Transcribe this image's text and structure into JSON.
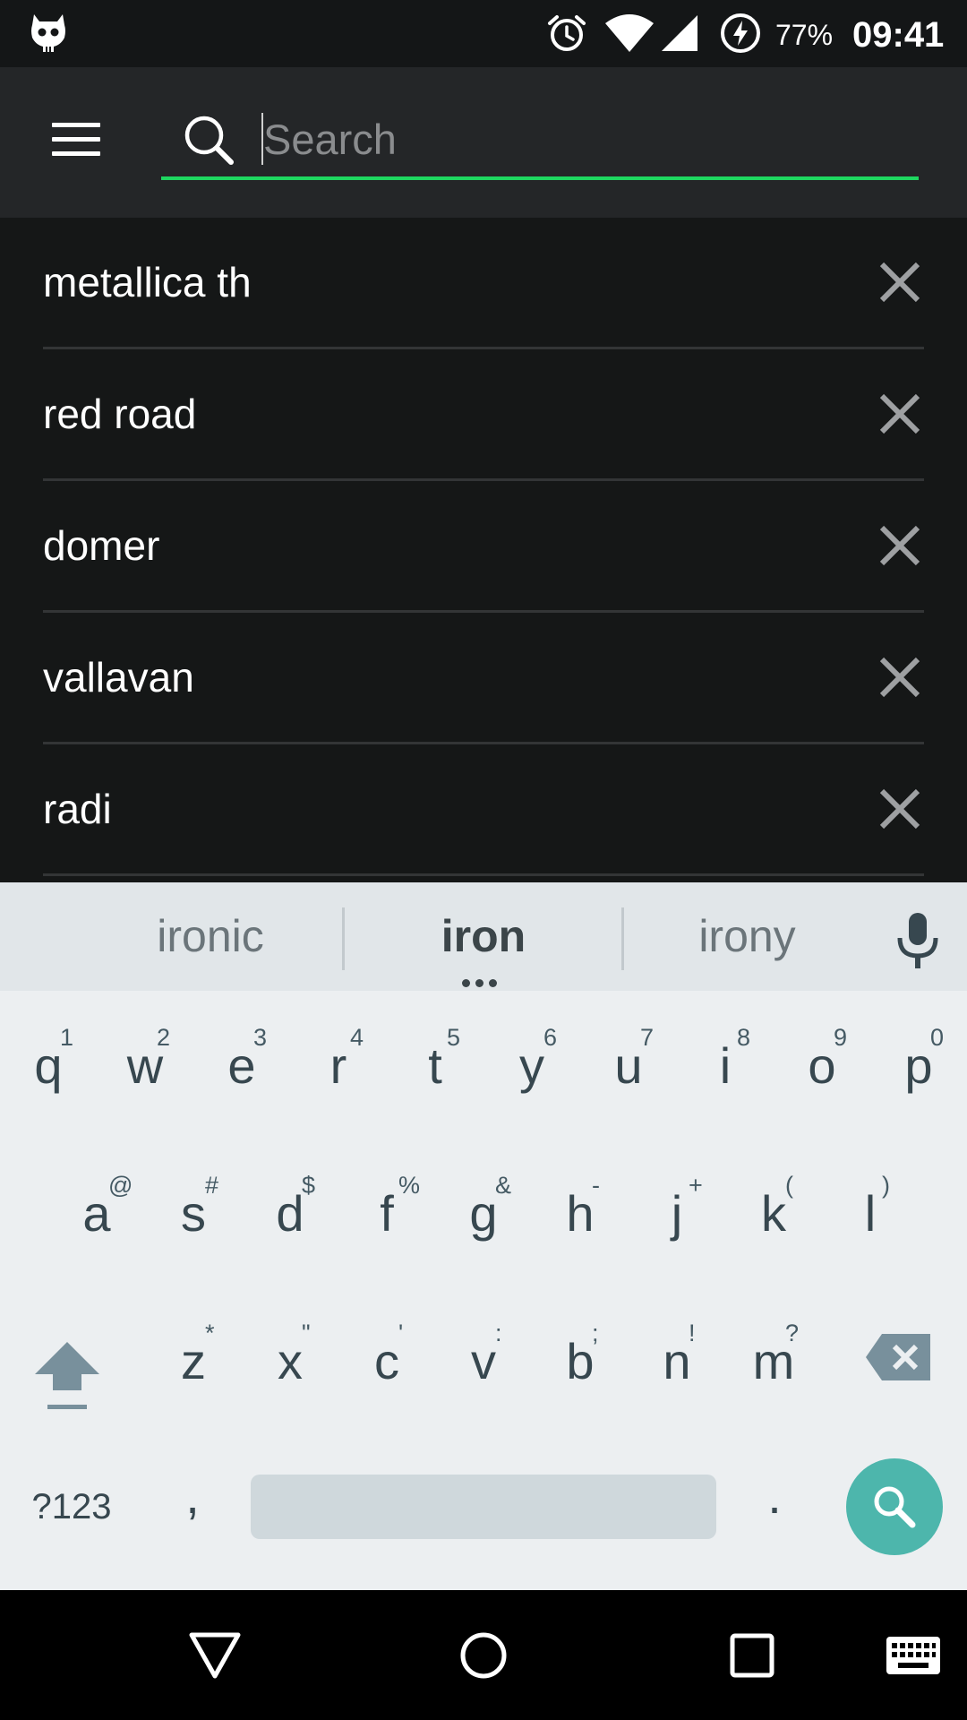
{
  "status_bar": {
    "battery_text": "77%",
    "time": "09:41",
    "icons": [
      "cyanogen-mascot-icon",
      "alarm-icon",
      "wifi-icon",
      "cell-signal-icon",
      "battery-charging-icon"
    ]
  },
  "top_bar": {
    "menu_icon": "menu-icon",
    "search": {
      "placeholder": "Search",
      "value": "",
      "icon": "search-icon",
      "underline_color": "#1ed760"
    }
  },
  "recent_searches": [
    {
      "text": "metallica th",
      "remove_icon": "close-icon"
    },
    {
      "text": "red road",
      "remove_icon": "close-icon"
    },
    {
      "text": "domer",
      "remove_icon": "close-icon"
    },
    {
      "text": "vallavan",
      "remove_icon": "close-icon"
    },
    {
      "text": "radi",
      "remove_icon": "close-icon"
    }
  ],
  "keyboard": {
    "suggestions": [
      "ironic",
      "iron",
      "irony"
    ],
    "row1": [
      {
        "key": "q",
        "hint": "1"
      },
      {
        "key": "w",
        "hint": "2"
      },
      {
        "key": "e",
        "hint": "3"
      },
      {
        "key": "r",
        "hint": "4"
      },
      {
        "key": "t",
        "hint": "5"
      },
      {
        "key": "y",
        "hint": "6"
      },
      {
        "key": "u",
        "hint": "7"
      },
      {
        "key": "i",
        "hint": "8"
      },
      {
        "key": "o",
        "hint": "9"
      },
      {
        "key": "p",
        "hint": "0"
      }
    ],
    "row2": [
      {
        "key": "a",
        "hint": "@"
      },
      {
        "key": "s",
        "hint": "#"
      },
      {
        "key": "d",
        "hint": "$"
      },
      {
        "key": "f",
        "hint": "%"
      },
      {
        "key": "g",
        "hint": "&"
      },
      {
        "key": "h",
        "hint": "-"
      },
      {
        "key": "j",
        "hint": "+"
      },
      {
        "key": "k",
        "hint": "("
      },
      {
        "key": "l",
        "hint": ")"
      }
    ],
    "row3": [
      {
        "key": "z",
        "hint": "*"
      },
      {
        "key": "x",
        "hint": "\""
      },
      {
        "key": "c",
        "hint": "'"
      },
      {
        "key": "v",
        "hint": ":"
      },
      {
        "key": "b",
        "hint": ";"
      },
      {
        "key": "n",
        "hint": "!"
      },
      {
        "key": "m",
        "hint": "?"
      }
    ],
    "symbols_label": "?123",
    "comma_label": ",",
    "period_label": ".",
    "action_color": "#4db6ac"
  },
  "nav_bar": {
    "icons": [
      "back-icon",
      "home-icon",
      "recents-icon",
      "keyboard-switch-icon"
    ]
  }
}
